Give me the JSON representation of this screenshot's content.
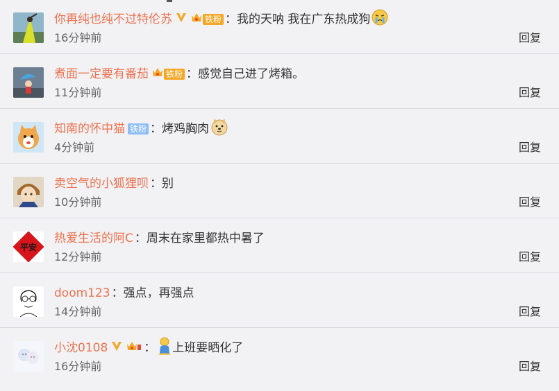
{
  "reply_label": "回复",
  "comments": [
    {
      "username": "你再纯也纯不过特伦苏",
      "text": "我的天呐 我在广东热成狗",
      "time": "16分钟前",
      "fan_label": "铁粉"
    },
    {
      "username": "煮面一定要有番茄",
      "text": "感觉自己进了烤箱。",
      "time": "11分钟前",
      "fan_label": "铁粉"
    },
    {
      "username": "知南的怀中猫",
      "text": "烤鸡胸肉",
      "time": "4分钟前",
      "fan_label": "铁粉"
    },
    {
      "username": "卖空气的小狐狸呗",
      "text": "别",
      "time": "10分钟前"
    },
    {
      "username": "热爱生活的阿C",
      "text": "周末在家里都热中暑了",
      "time": "12分钟前"
    },
    {
      "username": "doom123",
      "text": "强点，再强点",
      "time": "14分钟前"
    },
    {
      "username": "小沈0108",
      "text": "上班要晒化了",
      "time": "16分钟前"
    }
  ],
  "avatar_text": {
    "ping_an": "平安"
  },
  "colors": {
    "username": "#eb7350",
    "background": "#f2f2f5",
    "gold_badge": "#f5a623",
    "blue_badge": "#8ebef5",
    "vip_v": "#f5a623"
  }
}
